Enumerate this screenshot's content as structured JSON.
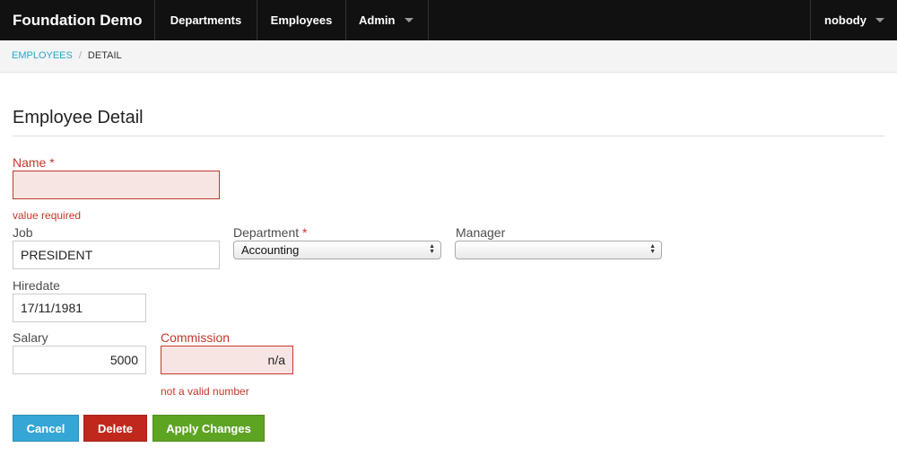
{
  "topbar": {
    "brand": "Foundation Demo",
    "nav": {
      "departments": "Departments",
      "employees": "Employees",
      "admin": "Admin"
    },
    "user": "nobody"
  },
  "breadcrumb": {
    "employees": "EMPLOYEES",
    "separator": "/",
    "current": "DETAIL"
  },
  "page": {
    "title": "Employee Detail"
  },
  "form": {
    "name": {
      "label": "Name",
      "required_mark": "*",
      "value": "",
      "error": "value required"
    },
    "job": {
      "label": "Job",
      "value": "PRESIDENT"
    },
    "department": {
      "label": "Department",
      "required_mark": "*",
      "selected": "Accounting"
    },
    "manager": {
      "label": "Manager",
      "selected": ""
    },
    "hiredate": {
      "label": "Hiredate",
      "value": "17/11/1981"
    },
    "salary": {
      "label": "Salary",
      "value": "5000"
    },
    "commission": {
      "label": "Commission",
      "value": "n/a",
      "error": "not a valid number"
    }
  },
  "buttons": {
    "cancel": "Cancel",
    "delete": "Delete",
    "apply": "Apply Changes"
  },
  "colors": {
    "error": "#c0392b",
    "cancel": "#36a6d6",
    "delete": "#c0281c",
    "apply": "#5da423",
    "topbar": "#111111"
  }
}
